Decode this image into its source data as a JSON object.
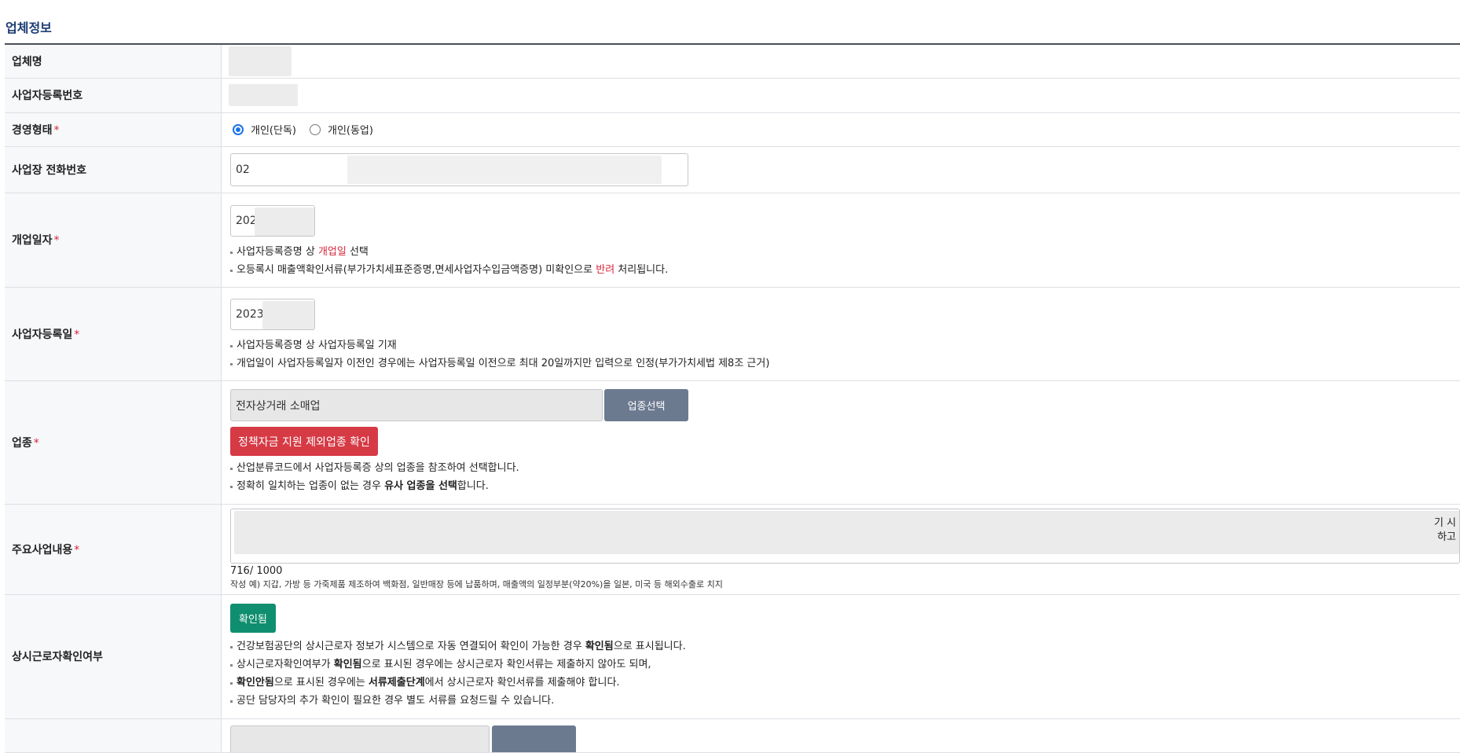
{
  "section_title": "업체정보",
  "rows": {
    "company_name": {
      "label": "업체명"
    },
    "biz_reg_no": {
      "label": "사업자등록번호"
    },
    "mgmt_type": {
      "label": "경영형태",
      "required_mark": "*",
      "options": [
        "개인(단독)",
        "개인(동업)"
      ],
      "selected": "개인(단독)"
    },
    "phone": {
      "label": "사업장 전화번호",
      "value": "02"
    },
    "open_date": {
      "label": "개업일자",
      "required_mark": "*",
      "value": "202",
      "notes": {
        "n1_pre": "사업자등록증명 상 ",
        "n1_red": "개업일",
        "n1_post": " 선택",
        "n2_pre": "오등록시 매출액확인서류(부가가치세표준증명,면세사업자수입금액증명) 미확인으로 ",
        "n2_red": "반려",
        "n2_post": " 처리됩니다."
      }
    },
    "reg_date": {
      "label": "사업자등록일",
      "required_mark": "*",
      "value": "2023",
      "notes": [
        "사업자등록증명 상 사업자등록일 기재",
        "개업일이 사업자등록일자 이전인 경우에는 사업자등록일 이전으로 최대 20일까지만 입력으로 인정(부가가치세법 제8조 근거)"
      ]
    },
    "industry": {
      "label": "업종",
      "required_mark": "*",
      "value": "전자상거래 소매업",
      "select_button": "업종선택",
      "exclusion_button": "정책자금 지원 제외업종 확인",
      "notes": {
        "n1": "산업분류코드에서 사업자등록증 상의 업종을 참조하여 선택합니다.",
        "n2_pre": "정확히 일치하는 업종이 없는 경우 ",
        "n2_bold": "유사 업종을 선택",
        "n2_post": "합니다."
      }
    },
    "main_business": {
      "label": "주요사업내용",
      "required_mark": "*",
      "text_line1": "기 시",
      "text_line2": "하고",
      "counter": "716/ 1000",
      "example": "작성 예) 지갑, 가방 등 가죽제품 제조하여 백화점, 일반매장 등에 납품하며, 매출액의 일정부분(약20%)을 일본, 미국 등 해외수출로 치지"
    },
    "worker_check": {
      "label": "상시근로자확인여부",
      "status_button": "확인됨",
      "notes": {
        "n1_pre": "건강보험공단의 상시근로자 정보가 시스템으로 자동 연결되어 확인이 가능한 경우 ",
        "n1_bold": "확인됨",
        "n1_post": "으로 표시됩니다.",
        "n2_pre": "상시근로자확인여부가 ",
        "n2_bold": "확인됨",
        "n2_post": "으로 표시된 경우에는 상시근로자 확인서류는 제출하지 않아도 되며,",
        "n3_bold1": "확인안됨",
        "n3_mid": "으로 표시된 경우에는 ",
        "n3_bold2": "서류제출단계",
        "n3_post": "에서 상시근로자 확인서류를 제출해야 합니다.",
        "n4": "공단 담당자의 추가 확인이 필요한 경우 별도 서류를 요청드릴 수 있습니다."
      }
    }
  },
  "colors": {
    "accent_blue": "#1a73e8",
    "required_red": "#d6263b",
    "button_gray": "#6c7a90",
    "button_red": "#d63a45",
    "button_green": "#0f8f6f",
    "section_title": "#1a3b73"
  }
}
